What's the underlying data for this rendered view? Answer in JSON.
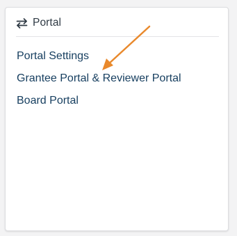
{
  "panel": {
    "title": "Portal",
    "title_icon": "swap-arrows-icon"
  },
  "links": [
    {
      "label": "Portal Settings"
    },
    {
      "label": "Grantee Portal & Reviewer Portal"
    },
    {
      "label": "Board Portal"
    }
  ],
  "annotation": {
    "arrow_color": "#e9892c",
    "points_to": "Grantee Portal & Reviewer Portal"
  },
  "colors": {
    "link": "#163e5f",
    "header_text": "#2f3a44",
    "background": "#f3f3f4",
    "card": "#ffffff"
  }
}
